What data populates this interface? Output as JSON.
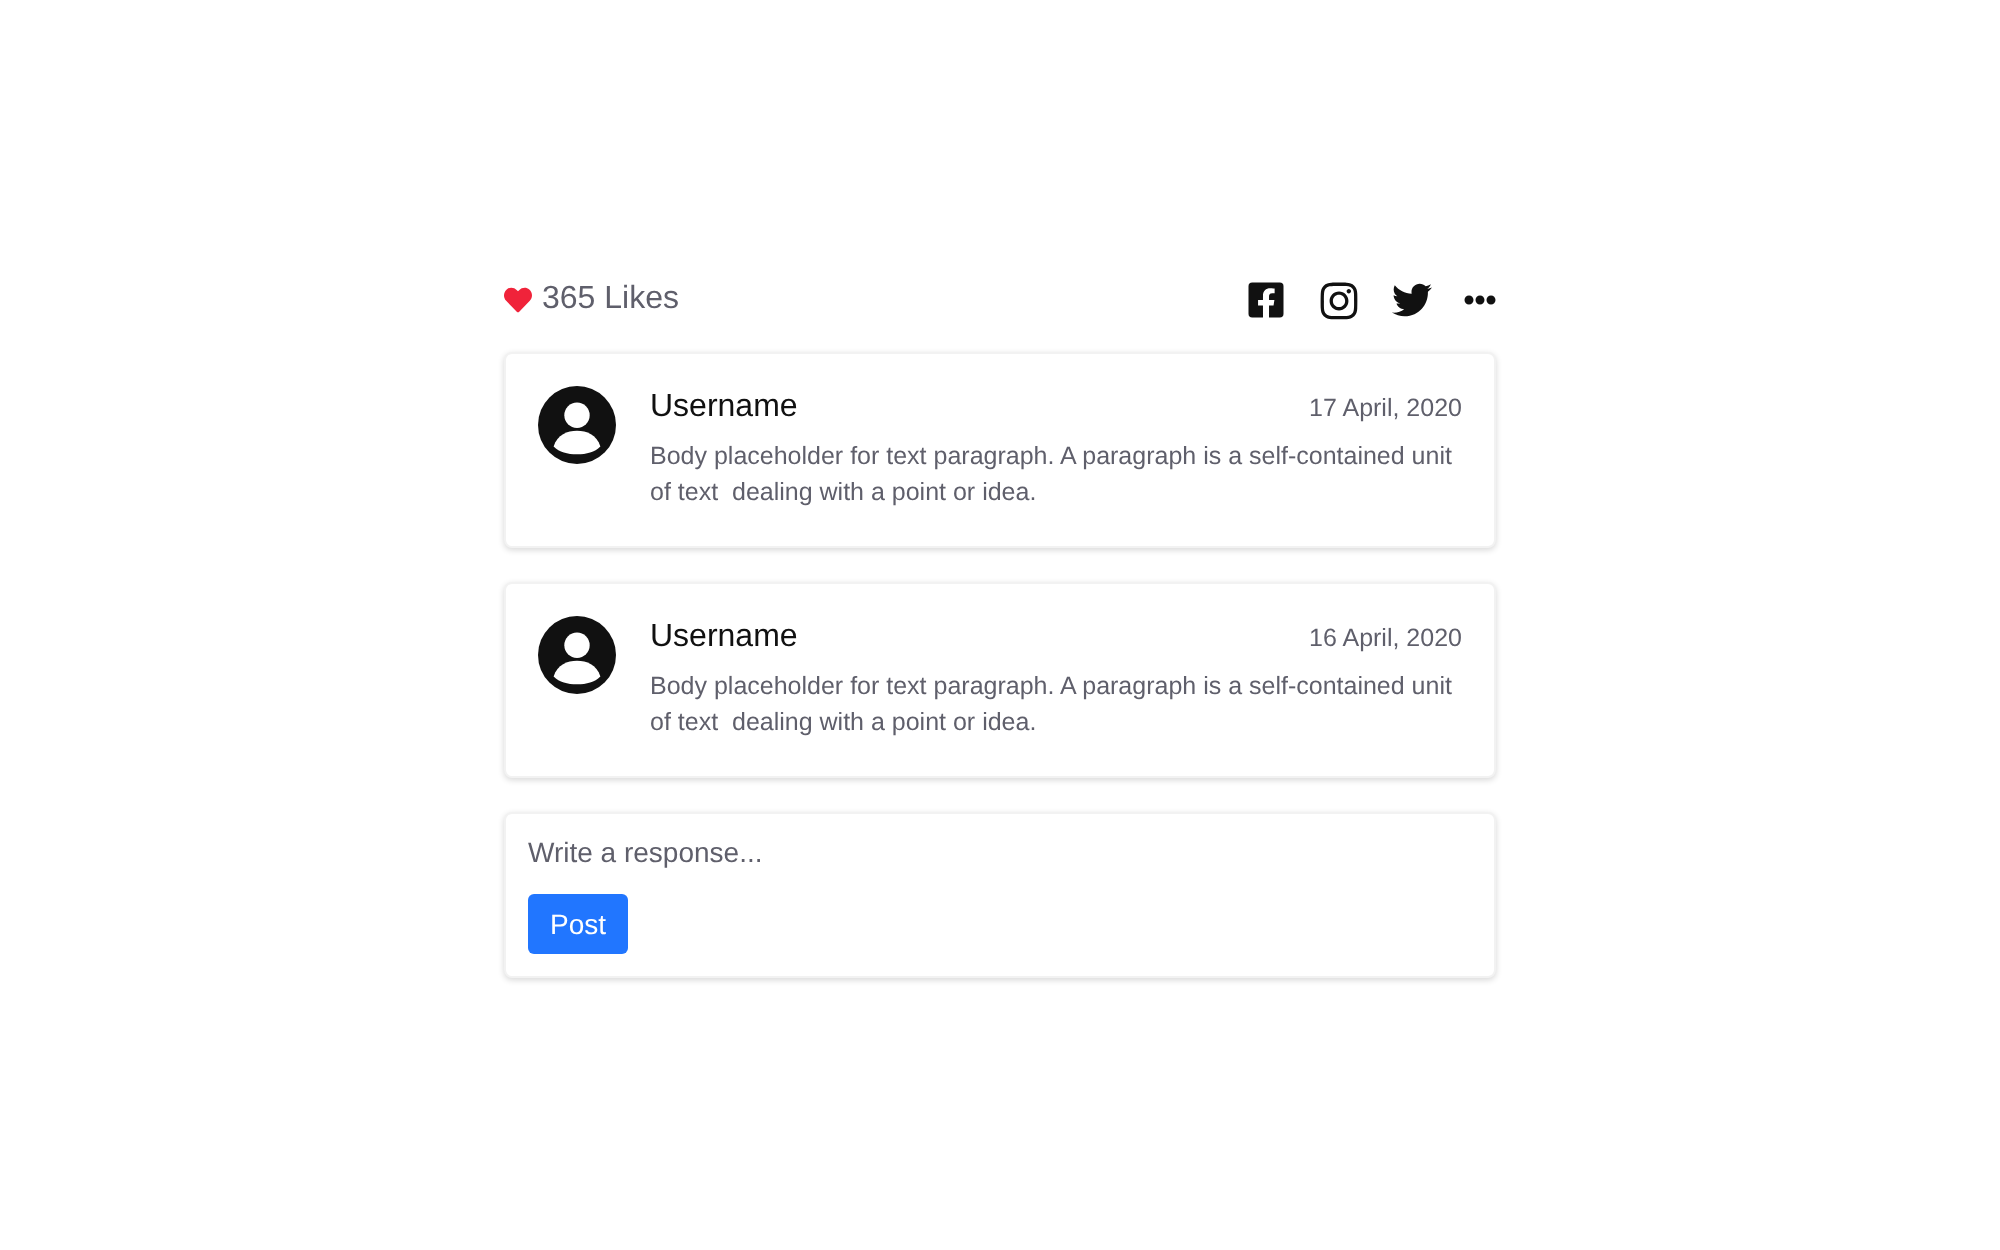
{
  "likes": {
    "label": "365 Likes"
  },
  "comments": [
    {
      "username": "Username",
      "date": "17 April, 2020",
      "body": "Body placeholder for text paragraph. A paragraph is a self-contained unit of text  dealing with a point or idea."
    },
    {
      "username": "Username",
      "date": "16 April, 2020",
      "body": "Body placeholder for text paragraph. A paragraph is a self-contained unit of text  dealing with a point or idea."
    }
  ],
  "response": {
    "placeholder": "Write a response...",
    "button": "Post"
  }
}
